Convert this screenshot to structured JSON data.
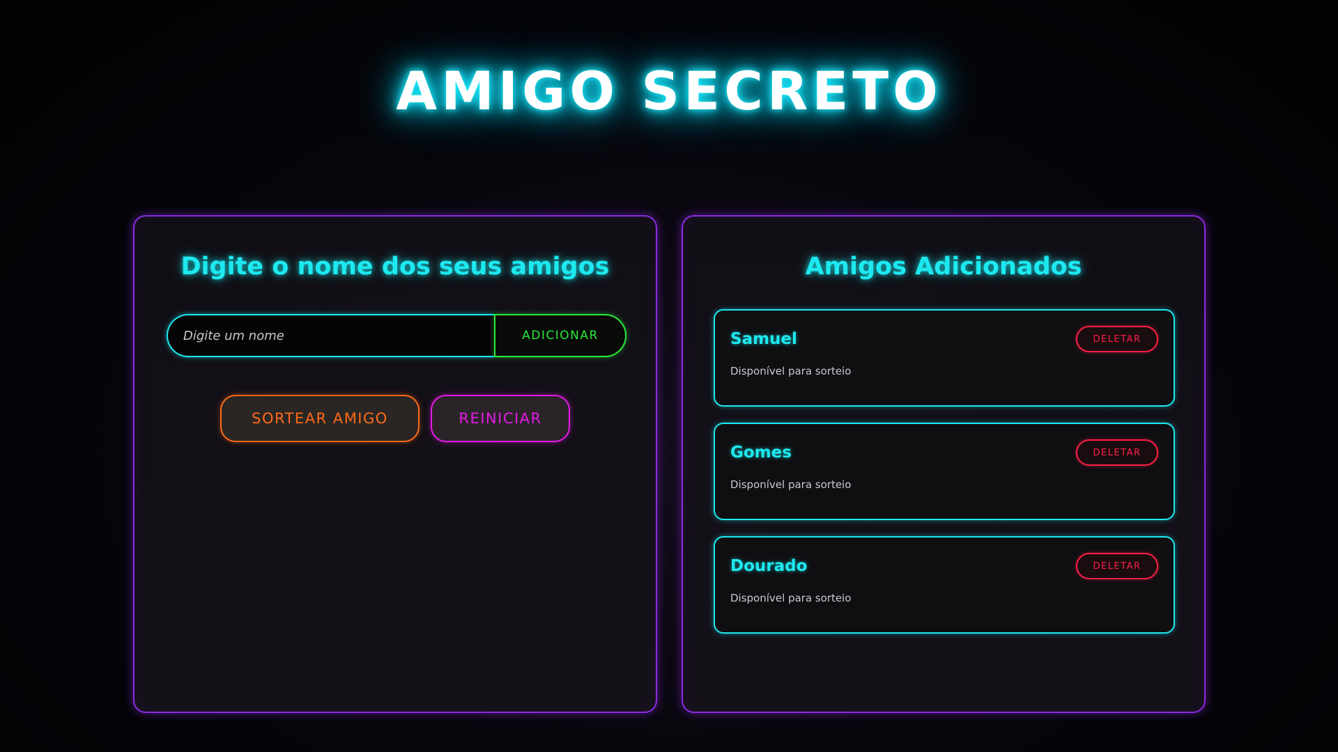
{
  "app": {
    "title": "AMIGO SECRETO"
  },
  "input_panel": {
    "heading": "Digite o nome dos seus amigos",
    "name_input": {
      "value": "",
      "placeholder": "Digite um nome"
    },
    "add_label": "ADICIONAR",
    "draw_label": "SORTEAR AMIGO",
    "reset_label": "REINICIAR"
  },
  "list_panel": {
    "heading": "Amigos Adicionados",
    "friends": [
      {
        "name": "Samuel",
        "status": "Disponível para sorteio",
        "delete_label": "DELETAR"
      },
      {
        "name": "Gomes",
        "status": "Disponível para sorteio",
        "delete_label": "DELETAR"
      },
      {
        "name": "Dourado",
        "status": "Disponível para sorteio",
        "delete_label": "DELETAR"
      }
    ]
  },
  "colors": {
    "title_glow": "#19e6ff",
    "panel_border": "#8a2be2",
    "cyan_accent": "#1de9f0",
    "add_green": "#2bea3a",
    "draw_orange": "#ff6a1a",
    "reset_magenta": "#e51be5",
    "delete_red": "#ff1f47"
  }
}
